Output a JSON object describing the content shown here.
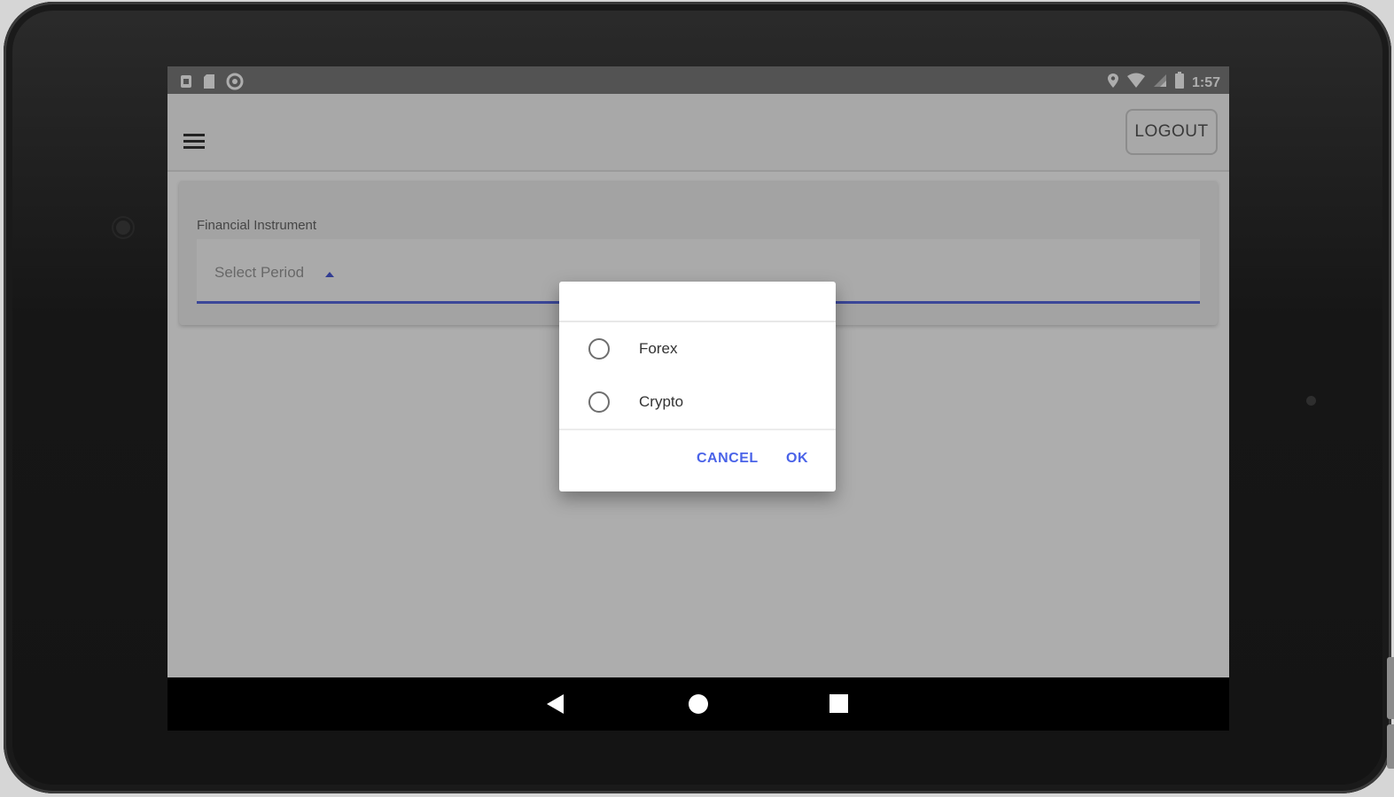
{
  "status_bar": {
    "left_icons": [
      "notification-box-icon",
      "sd-card-icon",
      "sync-circle-icon"
    ],
    "right_icons": [
      "location-icon",
      "wifi-icon",
      "cellular-signal-icon",
      "battery-icon"
    ],
    "time": "1:57"
  },
  "app_bar": {
    "menu_icon": "hamburger-menu-icon",
    "logout_label": "LOGOUT"
  },
  "form": {
    "field_label": "Financial Instrument",
    "select_placeholder": "Select Period",
    "select_caret_icon": "caret-up-icon"
  },
  "dialog": {
    "options": [
      {
        "label": "Forex",
        "selected": false
      },
      {
        "label": "Crypto",
        "selected": false
      }
    ],
    "cancel_label": "CANCEL",
    "ok_label": "OK"
  },
  "nav_bar": {
    "back_icon": "back-triangle-icon",
    "home_icon": "home-circle-icon",
    "recents_icon": "recents-square-icon"
  },
  "colors": {
    "accent": "#4a63e8",
    "status_bar": "#7b7b7b",
    "device_frame": "#161616"
  }
}
